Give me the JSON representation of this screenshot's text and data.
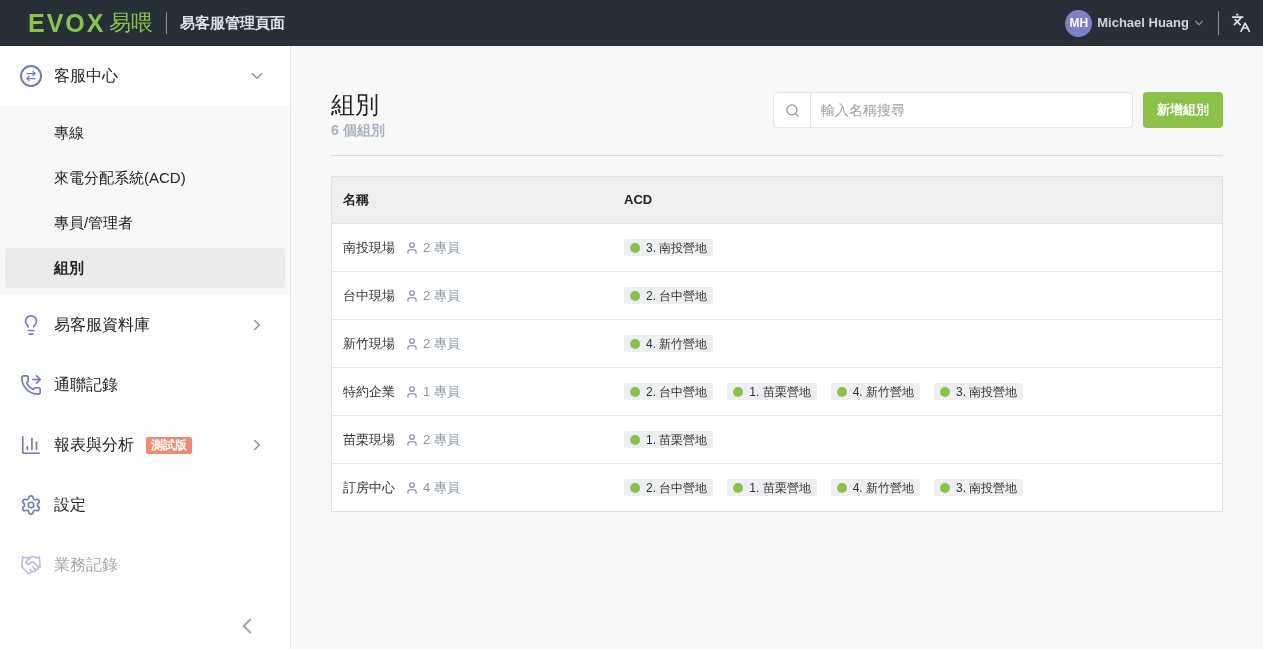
{
  "header": {
    "logo": "EVOX",
    "logo_cjk": "易喂",
    "title": "易客服管理頁面",
    "user": {
      "initials": "MH",
      "name": "Michael Huang"
    }
  },
  "sidebar": {
    "items": [
      {
        "kind": "group",
        "label": "客服中心",
        "expanded": true,
        "disabled": false,
        "children": [
          {
            "label": "專線",
            "selected": false
          },
          {
            "label": "來電分配系統(ACD)",
            "selected": false
          },
          {
            "label": "專員/管理者",
            "selected": false
          },
          {
            "label": "組別",
            "selected": true
          }
        ]
      },
      {
        "kind": "group",
        "label": "易客服資料庫",
        "expanded": false,
        "disabled": false
      },
      {
        "kind": "link",
        "label": "通聯記錄",
        "disabled": false
      },
      {
        "kind": "group",
        "label": "報表與分析",
        "badge": "測試版",
        "expanded": false,
        "disabled": false
      },
      {
        "kind": "link",
        "label": "設定",
        "disabled": false
      },
      {
        "kind": "link",
        "label": "業務記錄",
        "disabled": true
      }
    ]
  },
  "page": {
    "title": "組別",
    "subtitle": "6 個組別",
    "search": {
      "placeholder": "輸入名稱搜尋"
    },
    "add_button": "新增組別"
  },
  "table": {
    "columns": [
      "名稱",
      "ACD"
    ],
    "rows": [
      {
        "name": "南投現場",
        "members": "2 專員",
        "acd": [
          "3. 南投營地"
        ]
      },
      {
        "name": "台中現場",
        "members": "2 專員",
        "acd": [
          "2. 台中營地"
        ]
      },
      {
        "name": "新竹現場",
        "members": "2 專員",
        "acd": [
          "4. 新竹營地"
        ]
      },
      {
        "name": "特約企業",
        "members": "1 專員",
        "acd": [
          "2. 台中營地",
          "1. 苗栗營地",
          "4. 新竹營地",
          "3. 南投營地"
        ]
      },
      {
        "name": "苗栗現場",
        "members": "2 專員",
        "acd": [
          "1. 苗栗營地"
        ]
      },
      {
        "name": "訂房中心",
        "members": "4 專員",
        "acd": [
          "2. 台中營地",
          "1. 苗栗營地",
          "4. 新竹營地",
          "3. 南投營地"
        ]
      }
    ]
  }
}
